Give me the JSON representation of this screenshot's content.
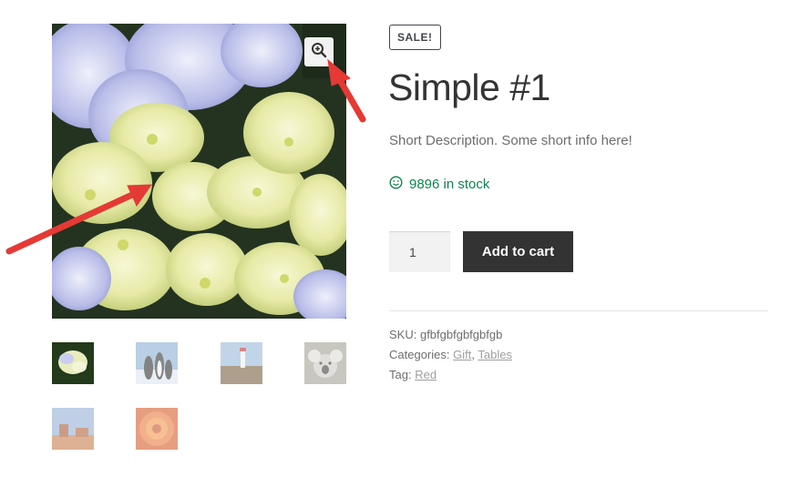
{
  "product": {
    "badge": "SALE!",
    "title": "Simple #1",
    "short_description": "Short Description. Some short info here!",
    "stock_text": "9896 in stock",
    "stock_icon": "smiley-icon",
    "quantity": "1",
    "add_to_cart_label": "Add to cart"
  },
  "meta": {
    "sku_label": "SKU:",
    "sku_value": "gfbfgbfgbfgbfgb",
    "categories_label": "Categories:",
    "categories": [
      "Gift",
      "Tables"
    ],
    "categories_sep": ",",
    "tag_label": "Tag:",
    "tag": "Red"
  },
  "gallery": {
    "zoom_icon": "zoom-in-icon",
    "thumbnails": [
      "hydrangea",
      "penguins",
      "lighthouse",
      "koala",
      "desert",
      "chrysanthemum"
    ]
  },
  "colors": {
    "stock_green": "#0f834d",
    "button_dark": "#333333",
    "annotation_red": "#e53935"
  }
}
